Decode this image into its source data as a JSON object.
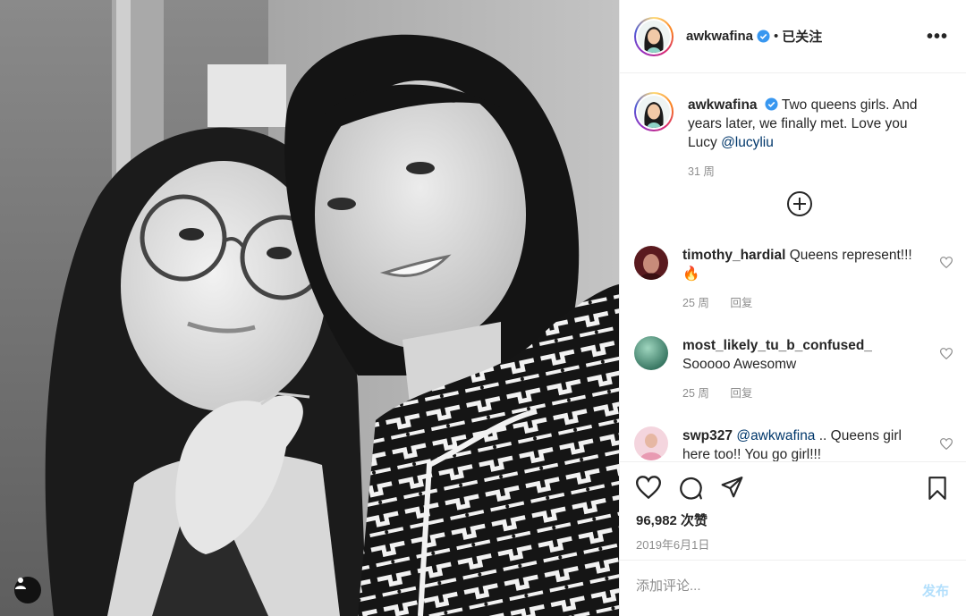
{
  "post": {
    "username": "awkwafina",
    "follow_status": "已关注",
    "separator": "•",
    "more_label": "•••",
    "caption": {
      "username": "awkwafina",
      "text": "Two queens girls. And years later, we finally met. Love you Lucy",
      "mention": "@lucyliu",
      "age": "31 周"
    },
    "comments": [
      {
        "username": "timothy_hardial",
        "text": "Queens represent!!! 🔥",
        "age": "25 周",
        "reply": "回复"
      },
      {
        "username": "most_likely_tu_b_confused_",
        "text": "Sooooo Awesomw",
        "age": "25 周",
        "reply": "回复"
      },
      {
        "username": "swp327",
        "mention": "@awkwafina",
        "text": ".. Queens girl here too!! You go girl!!!"
      }
    ],
    "likes": "96,982 次赞",
    "date": "2019年6月1日",
    "add_comment_placeholder": "添加评论...",
    "post_button": "发布"
  },
  "colors": {
    "verified": "#3897f0",
    "mention": "#00376b",
    "muted": "#8e8e8e",
    "post_button_disabled": "#b2dffc"
  },
  "icons": {
    "verified": "verified-badge-icon",
    "more": "more-options-icon",
    "expand": "plus-circle-icon",
    "like": "heart-icon",
    "comment": "comment-bubble-icon",
    "share": "paper-plane-icon",
    "save": "bookmark-icon",
    "tag": "user-tag-icon"
  }
}
